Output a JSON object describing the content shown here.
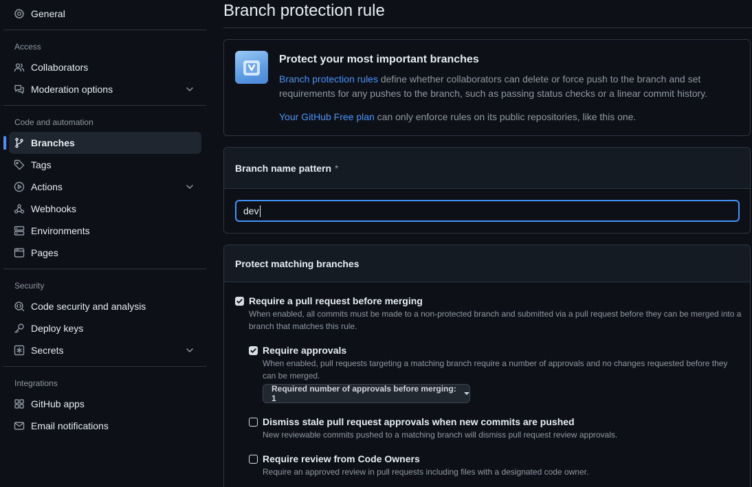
{
  "sidebar": {
    "general": "General",
    "access_heading": "Access",
    "collaborators": "Collaborators",
    "moderation": "Moderation options",
    "code_heading": "Code and automation",
    "branches": "Branches",
    "tags": "Tags",
    "actions": "Actions",
    "webhooks": "Webhooks",
    "environments": "Environments",
    "pages": "Pages",
    "security_heading": "Security",
    "code_security": "Code security and analysis",
    "deploy_keys": "Deploy keys",
    "secrets": "Secrets",
    "integrations_heading": "Integrations",
    "github_apps": "GitHub apps",
    "email_notifications": "Email notifications"
  },
  "main": {
    "title": "Branch protection rule",
    "promo": {
      "heading": "Protect your most important branches",
      "link_text": "Branch protection rules",
      "body": " define whether collaborators can delete or force push to the branch and set requirements for any pushes to the branch, such as passing status checks or a linear commit history.",
      "plan_link": "Your GitHub Free plan",
      "plan_text": " can only enforce rules on its public repositories, like this one."
    },
    "pattern": {
      "label": "Branch name pattern",
      "required_mark": "*",
      "value": "dev"
    },
    "protect": {
      "heading": "Protect matching branches",
      "rules": [
        {
          "label": "Require a pull request before merging",
          "checked": true,
          "description": "When enabled, all commits must be made to a non-protected branch and submitted via a pull request before they can be merged into a branch that matches this rule."
        },
        {
          "label": "Require approvals",
          "checked": true,
          "description": "When enabled, pull requests targeting a matching branch require a number of approvals and no changes requested before they can be merged."
        },
        {
          "label": "Dismiss stale pull request approvals when new commits are pushed",
          "checked": false,
          "description": "New reviewable commits pushed to a matching branch will dismiss pull request review approvals."
        },
        {
          "label": "Require review from Code Owners",
          "checked": false,
          "description": "Require an approved review in pull requests including files with a designated code owner."
        }
      ],
      "approvals_dropdown": "Required number of approvals before merging: 1"
    }
  },
  "colors": {
    "background": "#0d1117",
    "accent": "#4493f8",
    "border": "#30363d",
    "muted_text": "#9198a1"
  }
}
